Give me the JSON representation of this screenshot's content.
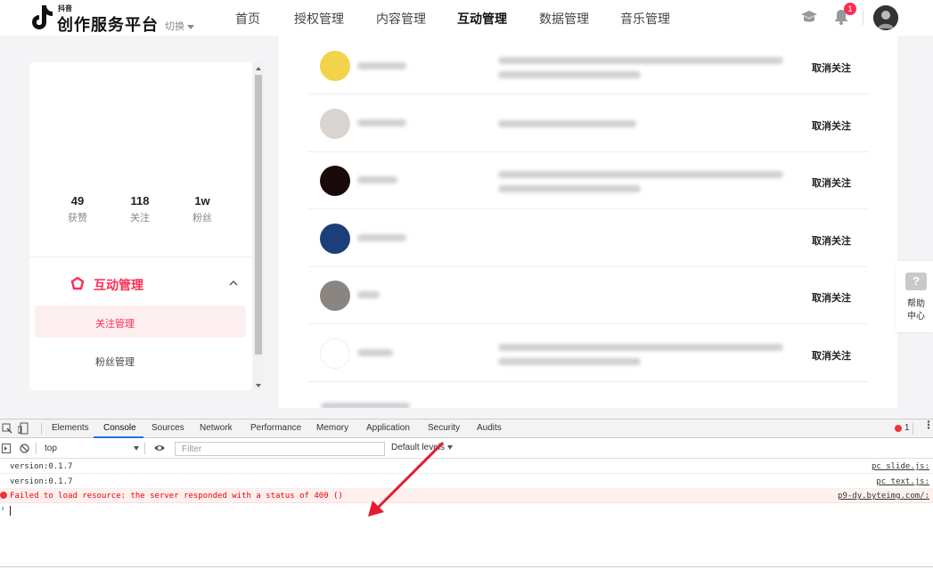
{
  "header": {
    "logo_small": "抖音",
    "logo_text": "创作服务平台",
    "switch_label": "切换",
    "nav": [
      {
        "label": "首页",
        "active": false
      },
      {
        "label": "授权管理",
        "active": false
      },
      {
        "label": "内容管理",
        "active": false
      },
      {
        "label": "互动管理",
        "active": true
      },
      {
        "label": "数据管理",
        "active": false
      },
      {
        "label": "音乐管理",
        "active": false
      }
    ],
    "notification_count": "1",
    "icons": [
      "graduation-cap-icon",
      "bell-icon",
      "user-avatar"
    ]
  },
  "sidebar": {
    "stats": [
      {
        "value": "49",
        "label": "获赞"
      },
      {
        "value": "118",
        "label": "关注"
      },
      {
        "value": "1w",
        "label": "粉丝"
      }
    ],
    "menu_group": "互动管理",
    "menu_items": [
      {
        "label": "关注管理",
        "selected": true
      },
      {
        "label": "粉丝管理",
        "selected": false
      }
    ]
  },
  "main": {
    "rows": [
      {
        "action": "取消关注",
        "avatar_color": "#f3d34a"
      },
      {
        "action": "取消关注",
        "avatar_color": "#d9d4cf"
      },
      {
        "action": "取消关注",
        "avatar_color": "#1a0a0a"
      },
      {
        "action": "取消关注",
        "avatar_color": "#1c3f7a"
      },
      {
        "action": "取消关注",
        "avatar_color": "#8a8580"
      },
      {
        "action": "取消关注",
        "avatar_color": "#ffffff"
      }
    ]
  },
  "help": {
    "icon": "question-icon",
    "label_line1": "帮助",
    "label_line2": "中心"
  },
  "devtools": {
    "tabs": [
      "Elements",
      "Console",
      "Sources",
      "Network",
      "Performance",
      "Memory",
      "Application",
      "Security",
      "Audits"
    ],
    "active_tab": "Console",
    "error_count": "1",
    "context": "top",
    "filter_placeholder": "Filter",
    "levels": "Default levels",
    "logs": [
      {
        "message": "version:0.1.7",
        "source": "pc_slide.js:",
        "type": "log"
      },
      {
        "message": "version:0.1.7",
        "source": "pc_text.js:",
        "type": "log"
      },
      {
        "message": "Failed to load resource: the server responded with a status of 400 ()",
        "source": "p9-dy.byteimg.com/:",
        "type": "error"
      }
    ]
  },
  "colors": {
    "brand": "#fe2c55",
    "link": "#1a73e8",
    "error": "#e00000"
  }
}
